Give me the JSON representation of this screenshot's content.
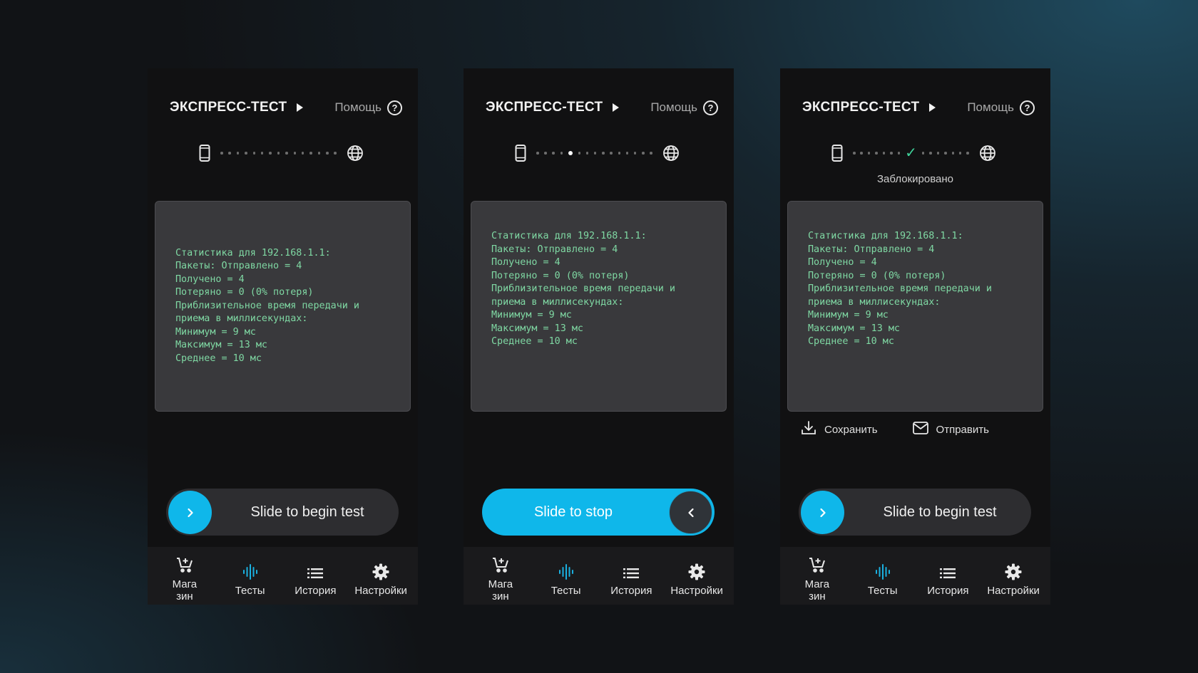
{
  "colors": {
    "accent": "#0fb7ea",
    "terminal_text": "#7fd8a3",
    "success": "#3fd29a"
  },
  "screens": [
    {
      "title": "ЭКСПРЕСС-ТЕСТ",
      "help": "Помощь",
      "route": {
        "left_icon": "phone-icon",
        "right_icon": "globe-icon",
        "dot_count": 15,
        "active_dot": -1,
        "checked": false
      },
      "status": "",
      "terminal": [
        "Статистика для 192.168.1.1:",
        "Пакеты: Отправлено = 4",
        "Получено = 4",
        "Потеряно = 0 (0% потеря)",
        "Приблизительное время передачи и",
        "приема в миллисекундах:",
        "Минимум = 9 мс",
        "Максимум = 13 мс",
        "Среднее = 10 мс"
      ],
      "actions": [],
      "slider": {
        "label": "Slide to begin test",
        "mode": "begin"
      },
      "nav": [
        {
          "label": "Мага\nзин",
          "icon": "cart-icon"
        },
        {
          "label": "Тесты",
          "icon": "waveform-icon"
        },
        {
          "label": "История",
          "icon": "list-icon"
        },
        {
          "label": "Настройки",
          "icon": "gear-icon"
        }
      ]
    },
    {
      "title": "ЭКСПРЕСС-ТЕСТ",
      "help": "Помощь",
      "route": {
        "left_icon": "phone-icon",
        "right_icon": "globe-icon",
        "dot_count": 15,
        "active_dot": 4,
        "checked": false
      },
      "status": "",
      "terminal": [
        "Статистика для 192.168.1.1:",
        "Пакеты: Отправлено = 4",
        "Получено = 4",
        "Потеряно = 0 (0% потеря)",
        "Приблизительное время передачи и",
        "приема в миллисекундах:",
        "Минимум = 9 мс",
        "Максимум = 13 мс",
        "Среднее = 10 мс"
      ],
      "actions": [],
      "slider": {
        "label": "Slide to stop",
        "mode": "stop"
      },
      "nav": [
        {
          "label": "Мага\nзин",
          "icon": "cart-icon"
        },
        {
          "label": "Тесты",
          "icon": "waveform-icon"
        },
        {
          "label": "История",
          "icon": "list-icon"
        },
        {
          "label": "Настройки",
          "icon": "gear-icon"
        }
      ]
    },
    {
      "title": "ЭКСПРЕСС-ТЕСТ",
      "help": "Помощь",
      "route": {
        "left_icon": "phone-icon",
        "right_icon": "globe-icon",
        "dot_count": 14,
        "active_dot": -1,
        "checked": true
      },
      "status": "Заблокировано",
      "terminal": [
        "Статистика для 192.168.1.1:",
        "Пакеты: Отправлено = 4",
        "Получено = 4",
        "Потеряно = 0 (0% потеря)",
        "Приблизительное время передачи и",
        "приема в миллисекундах:",
        "Минимум = 9 мс",
        "Максимум = 13 мс",
        "Среднее = 10 мс"
      ],
      "actions": [
        {
          "label": "Сохранить",
          "icon": "download-icon"
        },
        {
          "label": "Отправить",
          "icon": "mail-icon"
        }
      ],
      "slider": {
        "label": "Slide to begin test",
        "mode": "begin"
      },
      "nav": [
        {
          "label": "Мага\nзин",
          "icon": "cart-icon"
        },
        {
          "label": "Тесты",
          "icon": "waveform-icon"
        },
        {
          "label": "История",
          "icon": "list-icon"
        },
        {
          "label": "Настройки",
          "icon": "gear-icon"
        }
      ]
    }
  ]
}
